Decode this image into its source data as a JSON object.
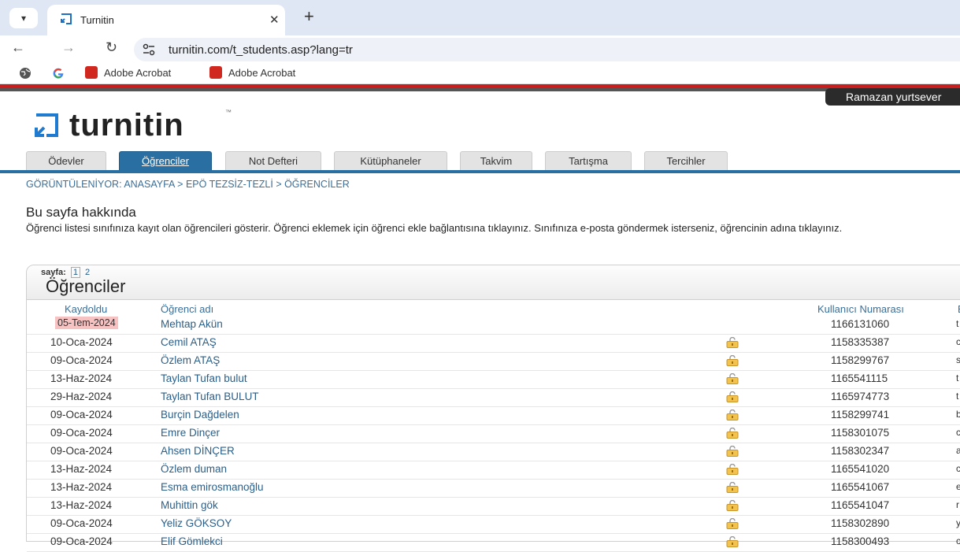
{
  "browser": {
    "tab_title": "Turnitin",
    "close_glyph": "✕",
    "new_tab_glyph": "+",
    "url": "turnitin.com/t_students.asp?lang=tr",
    "bookmarks": [
      "Adobe Acrobat",
      "Adobe Acrobat"
    ]
  },
  "header": {
    "user_name": "Ramazan yurtsever",
    "logo_text": "turnitin",
    "logo_tm": "™"
  },
  "nav_tabs": [
    "Ödevler",
    "Öğrenciler",
    "Not Defteri",
    "Kütüphaneler",
    "Takvim",
    "Tartışma",
    "Tercihler"
  ],
  "active_tab": "Öğrenciler",
  "breadcrumb": "GÖRÜNTÜLENİYOR: ANASAYFA > EPÖ TEZSİZ-TEZLİ > ÖĞRENCİLER",
  "about": {
    "heading": "Bu sayfa hakkında",
    "text": "Öğrenci listesi sınıfınıza kayıt olan öğrencileri gösterir. Öğrenci eklemek için öğrenci ekle bağlantısına tıklayınız. Sınıfınıza e-posta göndermek isterseniz, öğrencinin adına tıklayınız."
  },
  "students_panel": {
    "pager_label": "sayfa:",
    "pages": [
      "1",
      "2"
    ],
    "title": "Öğrenciler",
    "columns": [
      "Kaydoldu",
      "Öğrenci adı",
      "Kullanıcı Numarası",
      "E"
    ],
    "rows": [
      {
        "date": "05-Tem-2024",
        "name": "Mehtap Akün",
        "uid": "1166131060",
        "edge": "t",
        "lock": false,
        "highlight": true
      },
      {
        "date": "10-Oca-2024",
        "name": "Cemil ATAŞ",
        "uid": "1158335387",
        "edge": "c",
        "lock": true
      },
      {
        "date": "09-Oca-2024",
        "name": "Özlem ATAŞ",
        "uid": "1158299767",
        "edge": "s",
        "lock": true
      },
      {
        "date": "13-Haz-2024",
        "name": "Taylan Tufan bulut",
        "uid": "1165541115",
        "edge": "t",
        "lock": true
      },
      {
        "date": "29-Haz-2024",
        "name": "Taylan Tufan BULUT",
        "uid": "1165974773",
        "edge": "t",
        "lock": true
      },
      {
        "date": "09-Oca-2024",
        "name": "Burçin Dağdelen",
        "uid": "1158299741",
        "edge": "b",
        "lock": true
      },
      {
        "date": "09-Oca-2024",
        "name": "Emre Dinçer",
        "uid": "1158301075",
        "edge": "c",
        "lock": true
      },
      {
        "date": "09-Oca-2024",
        "name": "Ahsen DİNÇER",
        "uid": "1158302347",
        "edge": "a",
        "lock": true
      },
      {
        "date": "13-Haz-2024",
        "name": "Özlem duman",
        "uid": "1165541020",
        "edge": "c",
        "lock": true
      },
      {
        "date": "13-Haz-2024",
        "name": "Esma emirosmanoğlu",
        "uid": "1165541067",
        "edge": "e",
        "lock": true
      },
      {
        "date": "13-Haz-2024",
        "name": "Muhittin gök",
        "uid": "1165541047",
        "edge": "r",
        "lock": true
      },
      {
        "date": "09-Oca-2024",
        "name": "Yeliz GÖKSOY",
        "uid": "1158302890",
        "edge": "y",
        "lock": true
      },
      {
        "date": "09-Oca-2024",
        "name": "Elif Gömlekci",
        "uid": "1158300493",
        "edge": "c",
        "lock": true
      }
    ]
  },
  "colors": {
    "accent": "#2a6fa1",
    "brand_red": "#c81e1e",
    "link": "#2a5f8a",
    "new_badge": "#f6c2c2"
  }
}
